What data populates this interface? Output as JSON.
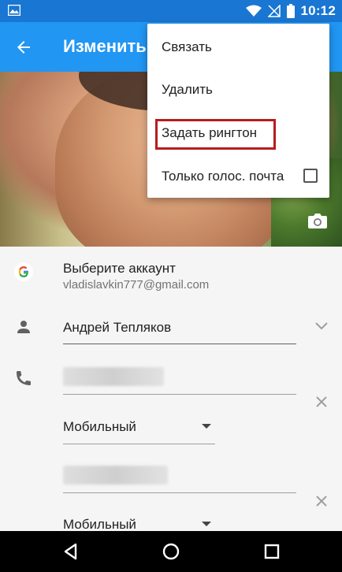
{
  "status_bar": {
    "time": "10:12"
  },
  "app_bar": {
    "title": "Изменить"
  },
  "menu": {
    "items": [
      {
        "label": "Связать"
      },
      {
        "label": "Удалить"
      },
      {
        "label": "Задать рингтон"
      },
      {
        "label": "Только голос. почта",
        "checked": false
      }
    ]
  },
  "account": {
    "title": "Выберите аккаунт",
    "email": "vladislavkin777@gmail.com"
  },
  "name_field": {
    "value": "Андрей Тепляков"
  },
  "phones": [
    {
      "type": "Мобильный"
    },
    {
      "type": "Мобильный"
    }
  ],
  "colors": {
    "primary": "#2196F3",
    "primary_dark": "#1976D2",
    "highlight": "#B71C1C"
  }
}
